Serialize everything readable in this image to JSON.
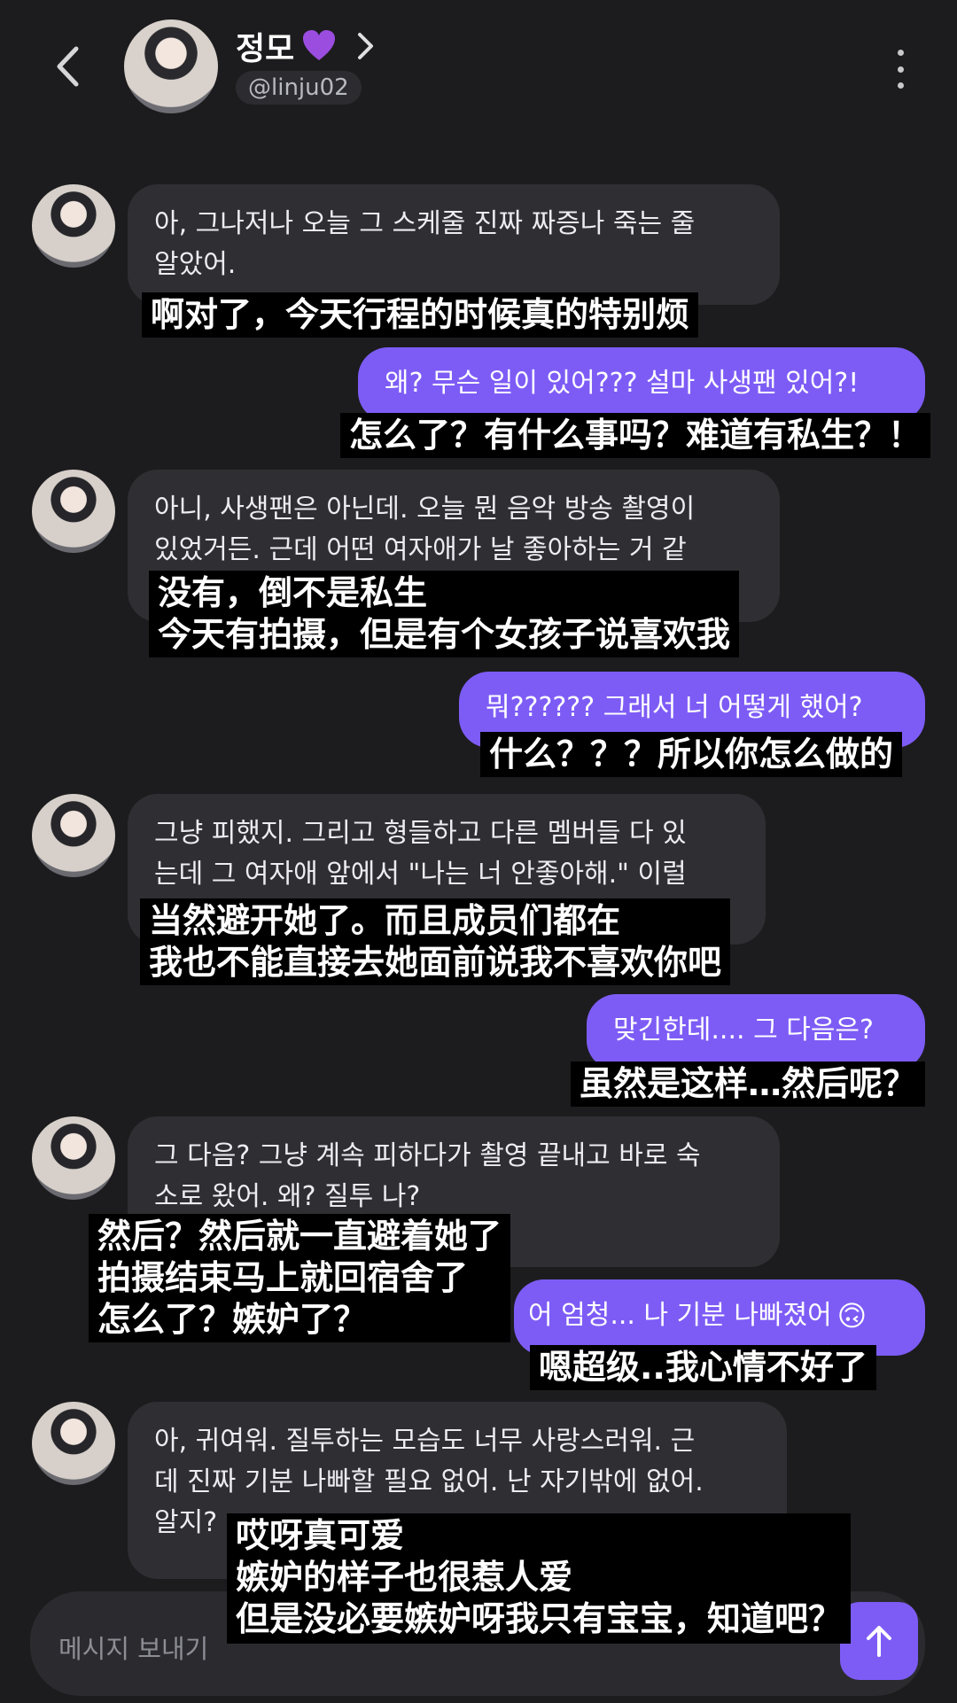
{
  "header": {
    "name": "정모",
    "handle": "@linju02"
  },
  "colors": {
    "accent": "#7d5cf6",
    "received_bubble": "#2f2f33",
    "background": "#1c1c1e"
  },
  "messages": [
    {
      "from": "friend",
      "text": "아, 그나저나 오늘 그 스케줄 진짜 짜증나 죽는 줄\n알았어.",
      "caption": "啊对了，今天行程的时候真的特别烦"
    },
    {
      "from": "me",
      "text": "왜? 무슨 일이 있어??? 설마 사생팬 있어?!",
      "caption": "怎么了？有什么事吗？难道有私生？！"
    },
    {
      "from": "friend",
      "text": "아니, 사생팬은 아닌데. 오늘 뭔 음악 방송 촬영이\n있었거든. 근데 어떤 여자애가 날 좋아하는 거 같",
      "caption": "没有，倒不是私生\n今天有拍摄，但是有个女孩子说喜欢我"
    },
    {
      "from": "me",
      "text": "뭐?????? 그래서 너 어떻게 했어?",
      "caption": "什么？？？所以你怎么做的"
    },
    {
      "from": "friend",
      "text": "그냥 피했지. 그리고 형들하고 다른 멤버들 다 있\n는데 그 여자애 앞에서 \"나는 너 안좋아해.\" 이럴",
      "caption": "当然避开她了。而且成员们都在\n我也不能直接去她面前说我不喜欢你吧"
    },
    {
      "from": "me",
      "text": "맞긴한데.... 그 다음은?",
      "caption": "虽然是这样…然后呢？"
    },
    {
      "from": "friend",
      "text": "그 다음? 그냥 계속 피하다가 촬영 끝내고 바로 숙\n소로 왔어. 왜? 질투 나?",
      "caption": "然后？然后就一直避着她了\n拍摄结束马上就回宿舍了\n怎么了？嫉妒了？"
    },
    {
      "from": "me",
      "text": "어 엄청... 나 기분 나빠졌어",
      "emoji": "🙃",
      "caption": "嗯超级..我心情不好了"
    },
    {
      "from": "friend",
      "text": "아, 귀여워. 질투하는 모습도 너무 사랑스러워. 근\n데 진짜 기분 나빠할 필요 없어. 난 자기밖에 없어.\n알지?",
      "caption": "哎呀真可爱\n嫉妒的样子也很惹人爱\n但是没必要嫉妒呀我只有宝宝，知道吧？"
    }
  ],
  "composer": {
    "placeholder": "메시지 보내기"
  }
}
